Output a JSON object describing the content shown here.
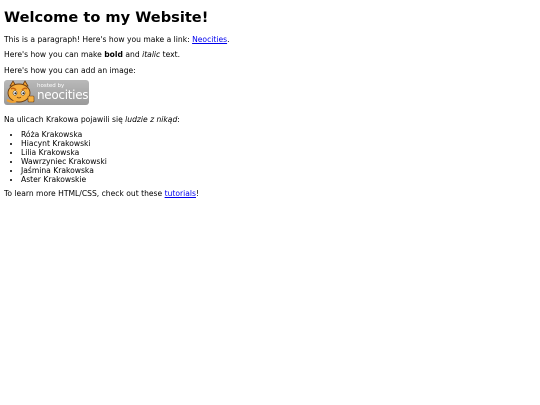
{
  "heading": "Welcome to my Website!",
  "para1": {
    "text": "This is a paragraph! Here's how you make a link: ",
    "link": "Neocities",
    "end": "."
  },
  "para2": {
    "before": "Here's how you can make ",
    "bold": "bold",
    "middle": " and ",
    "italic": "italic",
    "after": " text."
  },
  "para3": "Here's how you can add an image:",
  "badge": {
    "top_text": "hosted by",
    "main_text": "neocities"
  },
  "para4": {
    "before": "Na ulicach Krakowa pojawili się ",
    "italic": "ludzie z nikąd",
    "after": ":"
  },
  "list": [
    "Róża Krakowska",
    "Hiacynt Krakowski",
    "Lilia Krakowska",
    "Wawrzyniec Krakowski",
    "Jaśmina Krakowska",
    "Aster Krakowskie"
  ],
  "para5": {
    "before": "To learn more HTML/CSS, check out these ",
    "link": "tutorials",
    "after": "!"
  },
  "colors": {
    "link": "#0000ee",
    "badge_bg": "#a8a8a8",
    "cat_orange": "#f0a030"
  }
}
